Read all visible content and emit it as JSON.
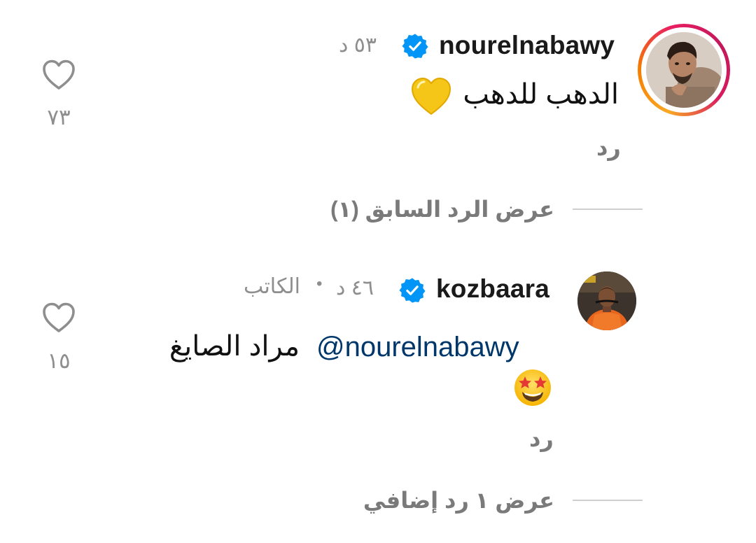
{
  "comments": [
    {
      "username": "nourelnabawy",
      "verified": true,
      "time": "٥٣ د",
      "text": "الدهب للدهب",
      "emoji": "yellow-heart",
      "reply_label": "رد",
      "likes": "٧٣",
      "view_replies_label": "عرض الرد السابق (١)",
      "has_story_ring": true
    },
    {
      "username": "kozbaara",
      "verified": true,
      "time": "٤٦ د",
      "separator": "•",
      "author_label": "الكاتب",
      "mention": "@nourelnabawy",
      "text": "مراد الصايغ",
      "emoji": "star-struck-face",
      "reply_label": "رد",
      "likes": "١٥",
      "view_replies_label": "عرض ١ رد إضافي",
      "has_story_ring": false
    }
  ],
  "colors": {
    "verified_blue": "#0095f6",
    "mention_blue": "#00376b",
    "meta_gray": "#8e8e8e",
    "story_ring": [
      "#f9a825",
      "#e91e63"
    ]
  }
}
